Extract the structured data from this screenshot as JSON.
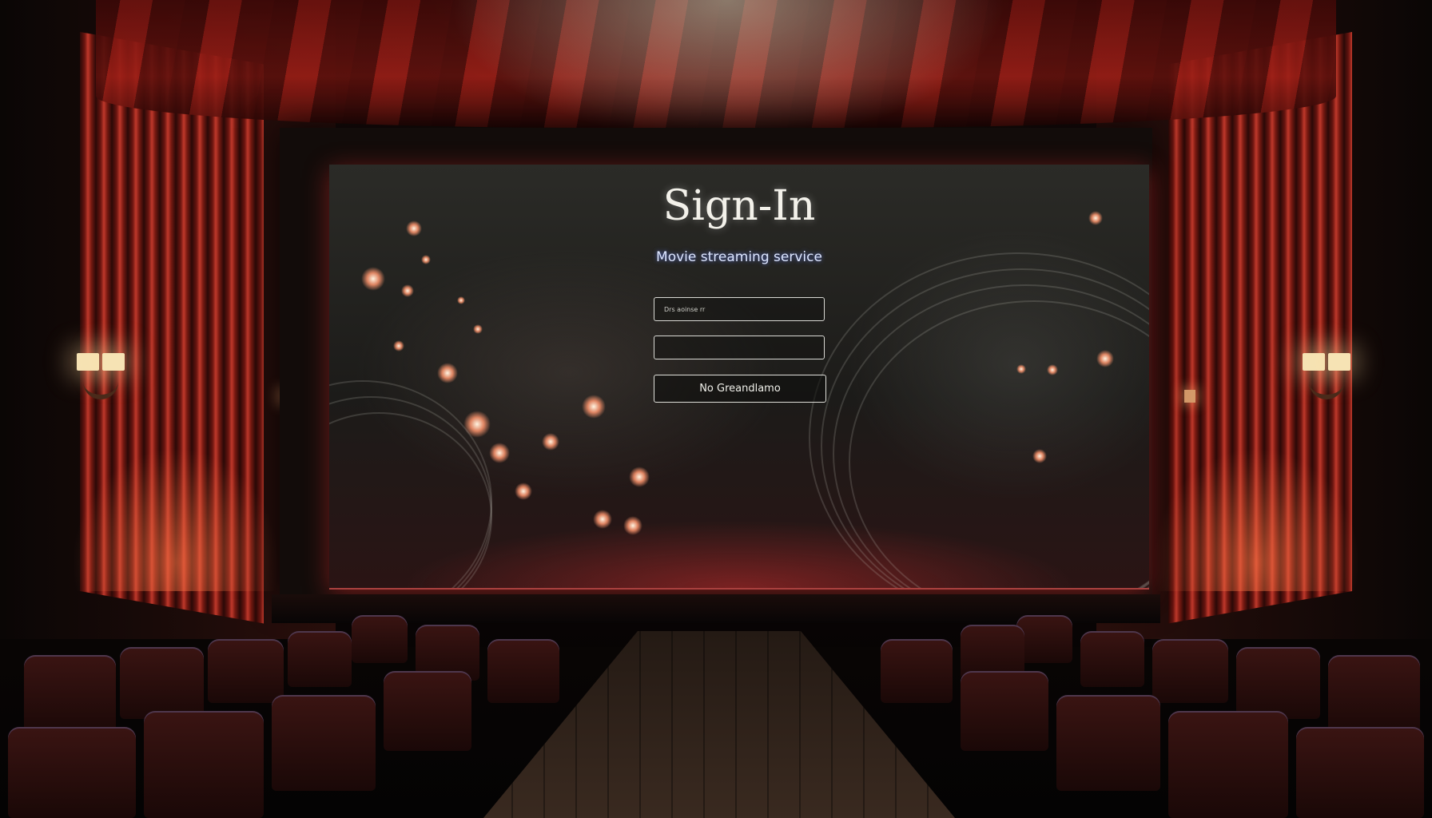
{
  "signin": {
    "title": "Sign-In",
    "subtitle": "Movie streaming service",
    "email_placeholder": "Drs aoinse rr",
    "password_placeholder": "",
    "submit_label": "No Greandlamo"
  },
  "colors": {
    "curtain": "#c0392b",
    "screen_glow": "#ff4040",
    "text": "#f3f1ea",
    "subtitle_glow": "#6482ff"
  }
}
